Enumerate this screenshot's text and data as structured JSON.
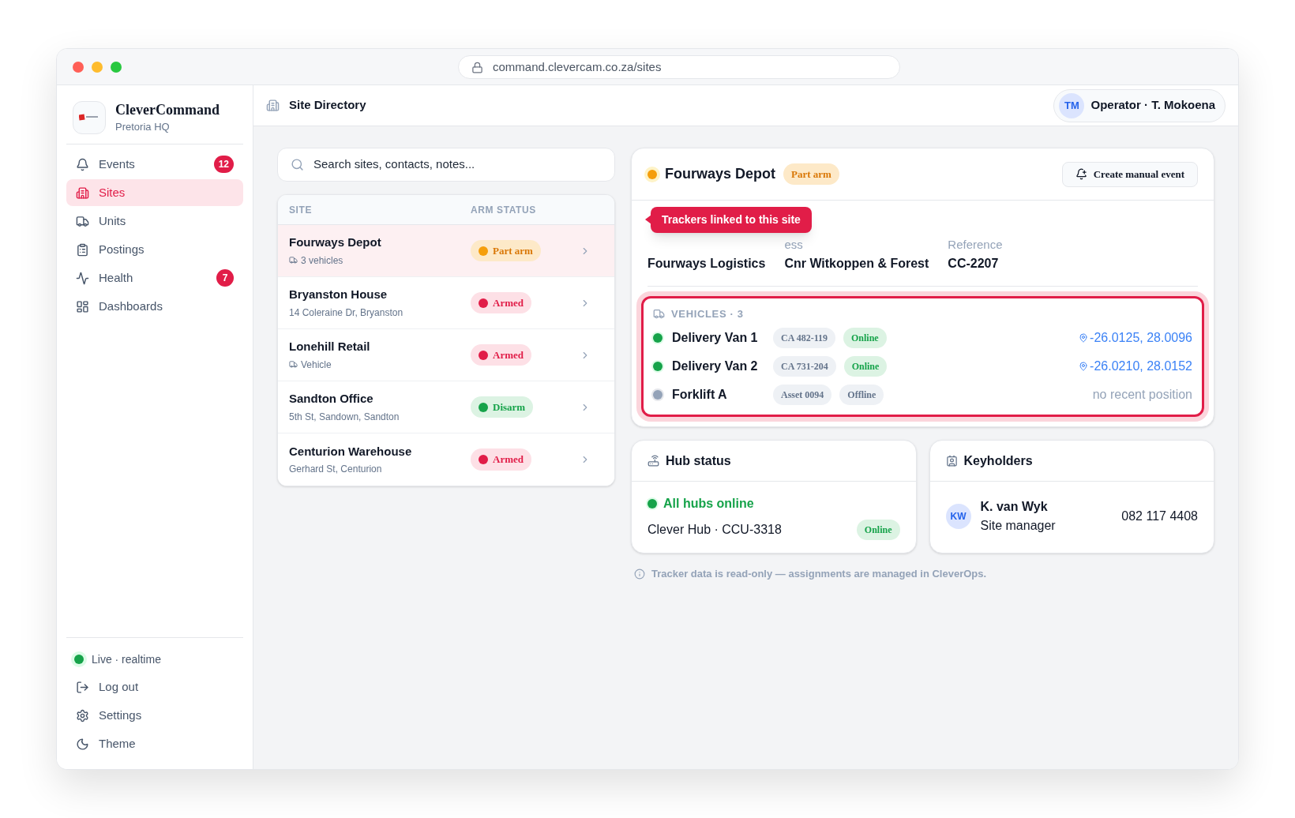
{
  "browser": {
    "url": "command.clevercam.co.za/sites"
  },
  "sidebar": {
    "brand": {
      "name": "CleverCommand",
      "subtitle": "Pretoria HQ"
    },
    "nav": [
      {
        "label": "Events",
        "badge": "12",
        "selected": false
      },
      {
        "label": "Sites",
        "selected": true
      },
      {
        "label": "Units",
        "selected": false
      },
      {
        "label": "Postings",
        "selected": false
      },
      {
        "label": "Health",
        "badge": "7",
        "selected": false
      },
      {
        "label": "Dashboards",
        "selected": false
      }
    ],
    "live": {
      "label": "Live · realtime",
      "on": true
    },
    "footer_items": [
      {
        "label": "Log out"
      },
      {
        "label": "Settings"
      },
      {
        "label": "Theme"
      }
    ]
  },
  "header": {
    "title": "Site Directory",
    "user": {
      "initials": "TM",
      "label": "Operator · T. Mokoena"
    }
  },
  "search": {
    "placeholder": "Search sites, contacts, notes..."
  },
  "table": {
    "columns": [
      "SITE",
      "ARM STATUS"
    ],
    "rows": [
      {
        "name": "Fourways Depot",
        "detail": "3 vehicles",
        "kind": "vehicle",
        "status": {
          "label": "Part arm",
          "kind": "part"
        },
        "selected": true
      },
      {
        "name": "Bryanston House",
        "detail": "14 Coleraine Dr, Bryanston",
        "kind": "address",
        "status": {
          "label": "Armed",
          "kind": "armed"
        },
        "selected": false
      },
      {
        "name": "Lonehill Retail",
        "detail": "Vehicle",
        "kind": "vehicle",
        "status": {
          "label": "Armed",
          "kind": "armed"
        },
        "selected": false
      },
      {
        "name": "Sandton Office",
        "detail": "5th St, Sandown, Sandton",
        "kind": "address",
        "status": {
          "label": "Disarm",
          "kind": "disarm"
        },
        "selected": false
      },
      {
        "name": "Centurion Warehouse",
        "detail": "Gerhard St, Centurion",
        "kind": "address",
        "status": {
          "label": "Armed",
          "kind": "armed"
        },
        "selected": false
      }
    ]
  },
  "detail": {
    "title": "Fourways Depot",
    "status": {
      "label": "Part arm",
      "kind": "part"
    },
    "button": "Create manual event",
    "tooltip": "Trackers linked to this site",
    "fields": [
      {
        "value": "Fourways Logistics"
      },
      {
        "label": "ess",
        "value": "Cnr Witkoppen & Forest"
      },
      {
        "label": "Reference",
        "value": "CC-2207"
      }
    ],
    "vehicles": {
      "heading": "VEHICLES · 3",
      "items": [
        {
          "name": "Delivery Van 1",
          "online": true,
          "plate": "CA 482-119",
          "badge": "Online",
          "position": "-26.0125, 28.0096",
          "kind": "coords"
        },
        {
          "name": "Delivery Van 2",
          "online": true,
          "plate": "CA 731-204",
          "badge": "Online",
          "position": "-26.0210, 28.0152",
          "kind": "coords"
        },
        {
          "name": "Forklift A",
          "online": false,
          "plate": "Asset 0094",
          "badge": "Offline",
          "position": "no recent position",
          "kind": "none"
        }
      ]
    }
  },
  "hub": {
    "title": "Hub status",
    "summary": "All hubs online",
    "online": true,
    "name": "Clever Hub · CCU-3318",
    "badge": "Online"
  },
  "keyholders": {
    "title": "Keyholders",
    "items": [
      {
        "initials": "KW",
        "name": "K. van Wyk",
        "role": "Site manager",
        "phone": "082 117 4408"
      }
    ]
  },
  "note": "Tracker data is read-only — assignments are managed in CleverOps."
}
